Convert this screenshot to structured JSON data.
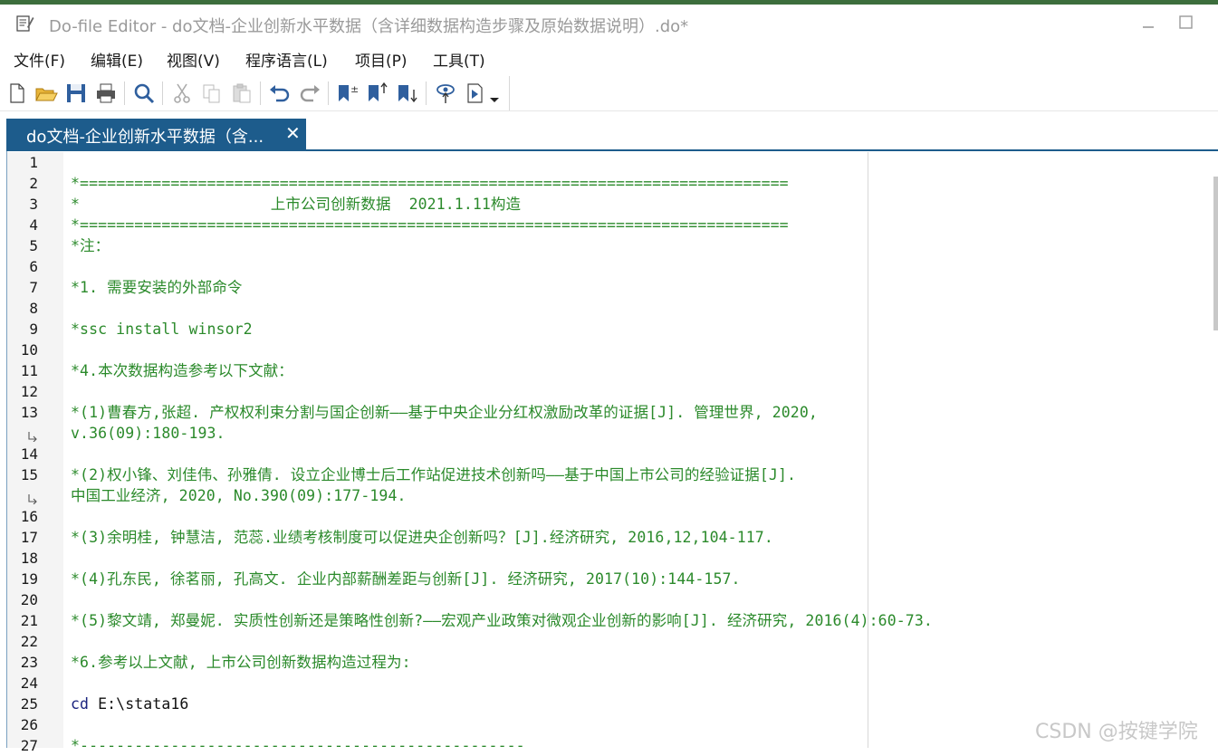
{
  "window": {
    "title": "Do-file Editor - do文档-企业创新水平数据（含详细数据构造步骤及原始数据说明）.do*"
  },
  "menu": [
    {
      "label": "文件(F)"
    },
    {
      "label": "编辑(E)"
    },
    {
      "label": "视图(V)"
    },
    {
      "label": "程序语言(L)"
    },
    {
      "label": "项目(P)"
    },
    {
      "label": "工具(T)"
    }
  ],
  "toolbar": {
    "icons": [
      "new-file-icon",
      "open-folder-icon",
      "save-icon",
      "print-icon",
      "search-icon",
      "cut-icon",
      "copy-icon",
      "paste-icon",
      "undo-icon",
      "redo-icon",
      "toggle-bookmark-icon",
      "previous-bookmark-icon",
      "next-bookmark-icon",
      "preview-icon",
      "execute-icon",
      "dropdown-arrow-icon"
    ]
  },
  "tab": {
    "label": "do文档-企业创新水平数据（含...",
    "close": "✕"
  },
  "lines": [
    {
      "n": "1",
      "text": "",
      "style": "txt"
    },
    {
      "n": "2",
      "text": "*==============================================================================",
      "style": "cmt"
    },
    {
      "n": "3",
      "text": "*                     上市公司创新数据  2021.1.11构造",
      "style": "cmt"
    },
    {
      "n": "4",
      "text": "*==============================================================================",
      "style": "cmt"
    },
    {
      "n": "5",
      "text": "*注：",
      "style": "cmt"
    },
    {
      "n": "6",
      "text": "",
      "style": "txt"
    },
    {
      "n": "7",
      "text": "*1. 需要安装的外部命令",
      "style": "cmt"
    },
    {
      "n": "8",
      "text": "",
      "style": "txt"
    },
    {
      "n": "9",
      "text": "*ssc install winsor2",
      "style": "cmt"
    },
    {
      "n": "10",
      "text": "",
      "style": "txt"
    },
    {
      "n": "11",
      "text": "*4.本次数据构造参考以下文献：",
      "style": "cmt"
    },
    {
      "n": "12",
      "text": "",
      "style": "txt"
    },
    {
      "n": "13",
      "text": "*(1)曹春方,张超. 产权权利束分割与国企创新——基于中央企业分红权激励改革的证据[J]. 管理世界, 2020,",
      "style": "cmt"
    },
    {
      "n": "",
      "text": "v.36(09):180-193.",
      "style": "cmt",
      "wrap": true
    },
    {
      "n": "14",
      "text": "",
      "style": "txt"
    },
    {
      "n": "15",
      "text": "*(2)权小锋、刘佳伟、孙雅倩. 设立企业博士后工作站促进技术创新吗——基于中国上市公司的经验证据[J].",
      "style": "cmt"
    },
    {
      "n": "",
      "text": "中国工业经济, 2020, No.390(09):177-194.",
      "style": "cmt",
      "wrap": true
    },
    {
      "n": "16",
      "text": "",
      "style": "txt"
    },
    {
      "n": "17",
      "text": "*(3)余明桂, 钟慧洁, 范蕊.业绩考核制度可以促进央企创新吗？[J].经济研究, 2016,12,104-117.",
      "style": "cmt"
    },
    {
      "n": "18",
      "text": "",
      "style": "txt"
    },
    {
      "n": "19",
      "text": "*(4)孔东民, 徐茗丽, 孔高文. 企业内部薪酬差距与创新[J]. 经济研究, 2017(10):144-157.",
      "style": "cmt"
    },
    {
      "n": "20",
      "text": "",
      "style": "txt"
    },
    {
      "n": "21",
      "text": "*(5)黎文靖, 郑曼妮. 实质性创新还是策略性创新?——宏观产业政策对微观企业创新的影响[J]. 经济研究, 2016(4):60-73.",
      "style": "cmt"
    },
    {
      "n": "22",
      "text": "",
      "style": "txt"
    },
    {
      "n": "23",
      "text": "*6.参考以上文献, 上市公司创新数据构造过程为:",
      "style": "cmt"
    },
    {
      "n": "24",
      "text": "",
      "style": "txt"
    },
    {
      "n": "25",
      "kw": "cd",
      "text": " E:\\stata16",
      "style": "kwline"
    },
    {
      "n": "26",
      "text": "",
      "style": "txt"
    },
    {
      "n": "27",
      "text": "*-------------------------------------------------",
      "style": "cmt"
    }
  ],
  "watermark": "CSDN @按键学院",
  "colors": {
    "comment": "#2b8a2b",
    "keyword": "#1a237e",
    "tab_active": "#1d5c8c",
    "title_text": "#9a9a9a"
  }
}
